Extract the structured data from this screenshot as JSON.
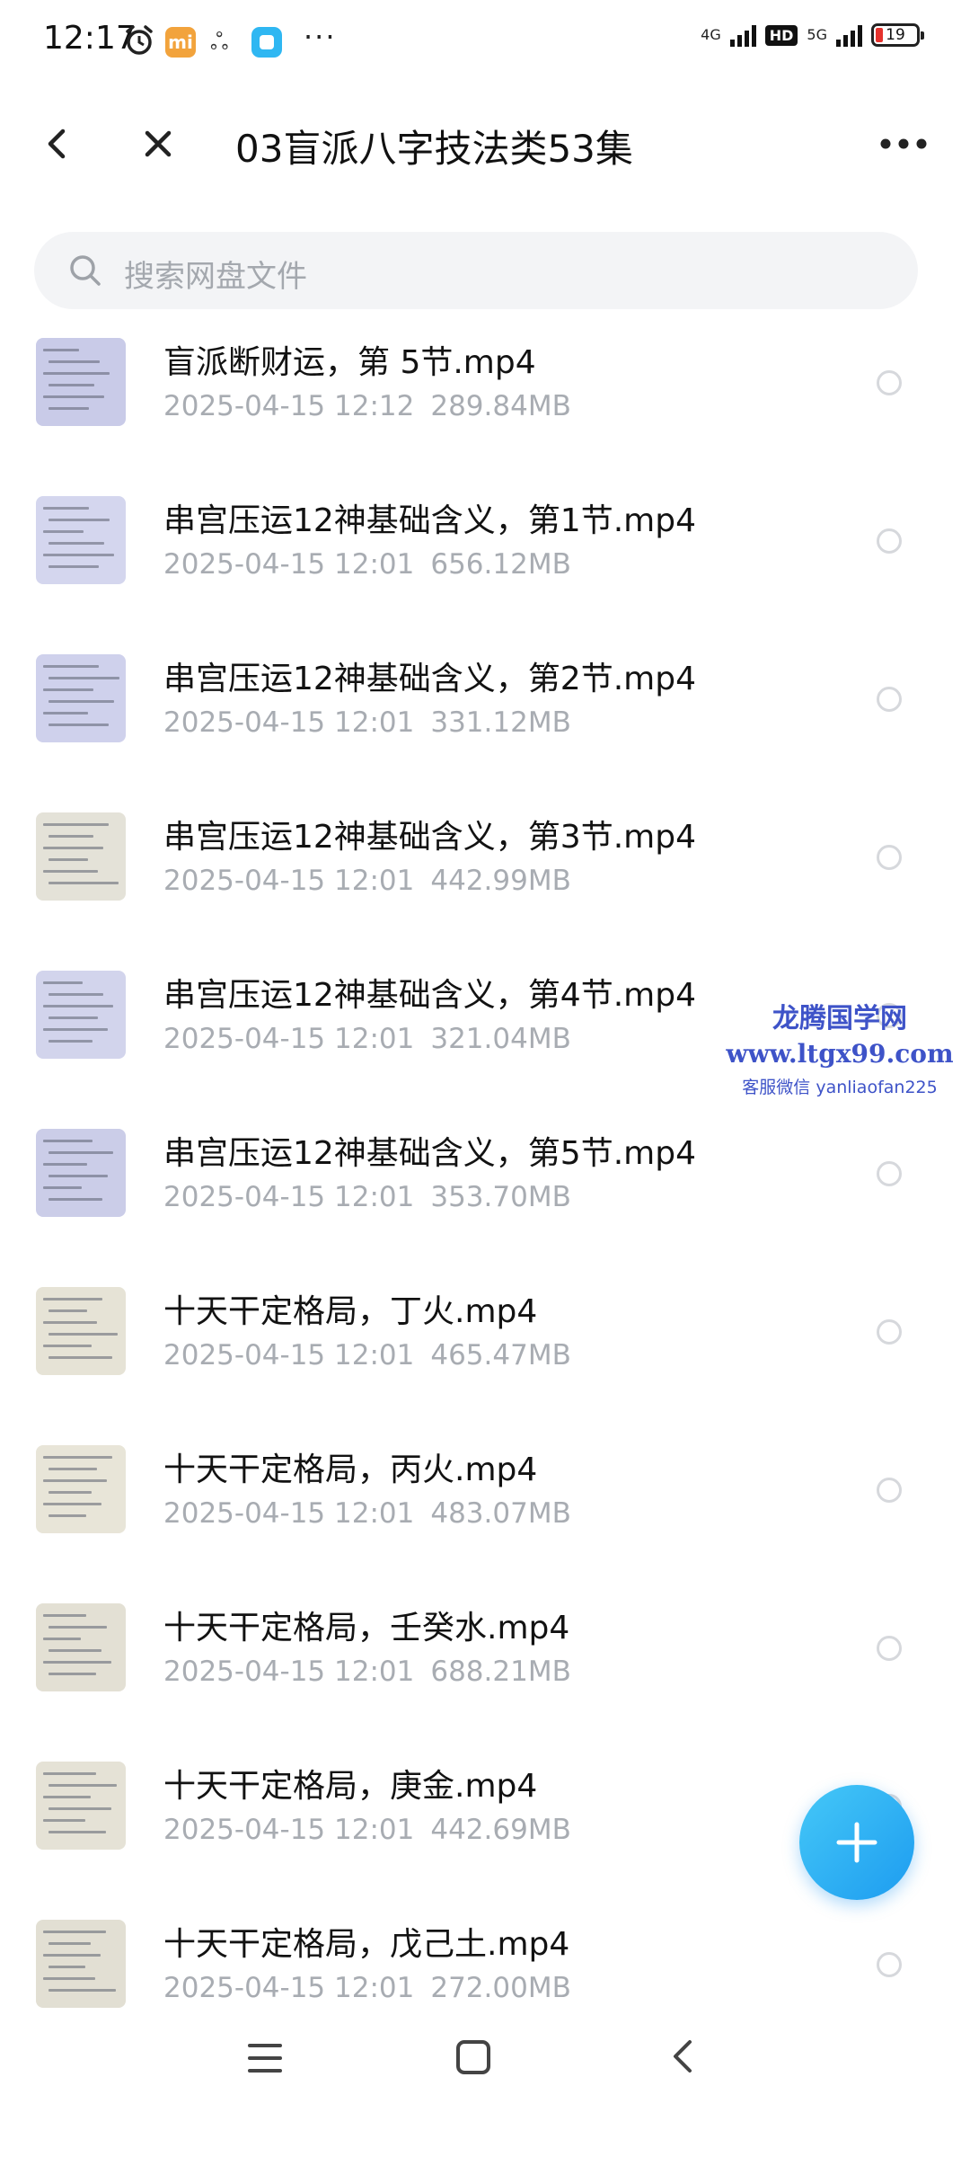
{
  "status_bar": {
    "time": "12:17",
    "network_1": "4G",
    "network_2": "5G",
    "hd": "HD",
    "battery": "19",
    "more": "···"
  },
  "header": {
    "title": "03盲派八字技法类53集"
  },
  "search": {
    "placeholder": "搜索网盘文件"
  },
  "files": [
    {
      "name": "盲派断财运，第 5节.mp4",
      "date": "2025-04-15  12:12",
      "size": "289.84MB",
      "thumb_color": "#c9cbe8"
    },
    {
      "name": "串宫压运12神基础含义，第1节.mp4",
      "date": "2025-04-15  12:01",
      "size": "656.12MB",
      "thumb_color": "#d4d6ee"
    },
    {
      "name": "串宫压运12神基础含义，第2节.mp4",
      "date": "2025-04-15  12:01",
      "size": "331.12MB",
      "thumb_color": "#cfd1ec"
    },
    {
      "name": "串宫压运12神基础含义，第3节.mp4",
      "date": "2025-04-15  12:01",
      "size": "442.99MB",
      "thumb_color": "#e4e2d8"
    },
    {
      "name": "串宫压运12神基础含义，第4节.mp4",
      "date": "2025-04-15  12:01",
      "size": "321.04MB",
      "thumb_color": "#d2d4ec"
    },
    {
      "name": "串宫压运12神基础含义，第5节.mp4",
      "date": "2025-04-15  12:01",
      "size": "353.70MB",
      "thumb_color": "#cbcde8"
    },
    {
      "name": "十天干定格局，丁火.mp4",
      "date": "2025-04-15  12:01",
      "size": "465.47MB",
      "thumb_color": "#e6e3d6"
    },
    {
      "name": "十天干定格局，丙火.mp4",
      "date": "2025-04-15  12:01",
      "size": "483.07MB",
      "thumb_color": "#e8e5d8"
    },
    {
      "name": "十天干定格局，壬癸水.mp4",
      "date": "2025-04-15  12:01",
      "size": "688.21MB",
      "thumb_color": "#e3e0d4"
    },
    {
      "name": "十天干定格局，庚金.mp4",
      "date": "2025-04-15  12:01",
      "size": "442.69MB",
      "thumb_color": "#e5e2d6"
    },
    {
      "name": "十天干定格局，戊己土.mp4",
      "date": "2025-04-15  12:01",
      "size": "272.00MB",
      "thumb_color": "#e2dfd3"
    }
  ],
  "watermark": {
    "line1": "龙腾国学网",
    "line2": "www.ltgx99.com",
    "line3": "客服微信 yanliaofan225"
  },
  "icons": {
    "back": "chevron-left-icon",
    "close": "close-icon",
    "more": "more-horizontal-icon",
    "search": "search-icon",
    "fab": "plus-icon"
  },
  "colors": {
    "accent": "#1d9cf0",
    "watermark": "#3e53c8",
    "meta_text": "#a8acb2"
  }
}
